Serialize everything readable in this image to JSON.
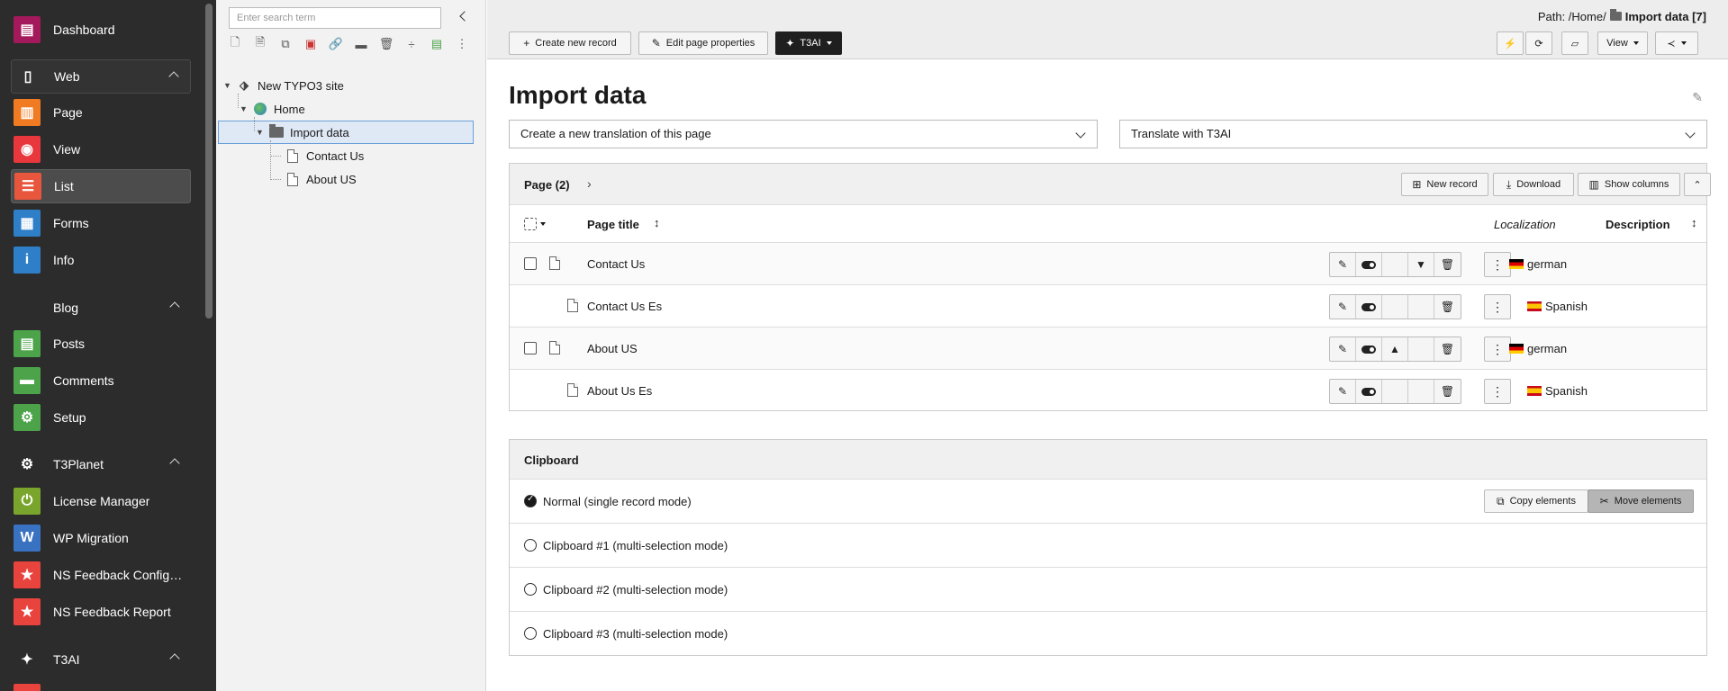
{
  "module_menu": {
    "items": [
      {
        "label": "Dashboard",
        "icon": "dashboard-icon",
        "color": "#a3195b"
      },
      {
        "label": "Web",
        "icon": "page-icon",
        "group": true
      },
      {
        "label": "Page",
        "icon": "page-module-icon",
        "color": "#f07b22"
      },
      {
        "label": "View",
        "icon": "eye-icon",
        "color": "#e8373d"
      },
      {
        "label": "List",
        "icon": "list-icon",
        "color": "#e8573d",
        "active": true
      },
      {
        "label": "Forms",
        "icon": "forms-icon",
        "color": "#2e7fc7"
      },
      {
        "label": "Info",
        "icon": "info-icon",
        "color": "#2e7fc7"
      },
      {
        "label": "Blog",
        "icon": "blog-icon",
        "group": true
      },
      {
        "label": "Posts",
        "icon": "posts-icon",
        "color": "#4ca34a"
      },
      {
        "label": "Comments",
        "icon": "comments-icon",
        "color": "#4ca34a"
      },
      {
        "label": "Setup",
        "icon": "setup-icon",
        "color": "#4ca34a"
      },
      {
        "label": "T3Planet",
        "icon": "gear-icon",
        "group": true
      },
      {
        "label": "License Manager",
        "icon": "license-icon",
        "color": "#7aa52d"
      },
      {
        "label": "WP Migration",
        "icon": "wordpress-icon",
        "color": "#3a72c2"
      },
      {
        "label": "NS Feedback Configur...",
        "icon": "star-icon",
        "color": "#e8433d"
      },
      {
        "label": "NS Feedback Report",
        "icon": "star-icon",
        "color": "#e8433d"
      },
      {
        "label": "T3AI",
        "icon": "sparkle-icon",
        "group": true
      }
    ]
  },
  "tree": {
    "search_placeholder": "Enter search term",
    "nodes": {
      "root": "New TYPO3 site",
      "home": "Home",
      "import": "Import data",
      "contact": "Contact Us",
      "about": "About US"
    }
  },
  "header": {
    "create_record": "Create new record",
    "edit_page": "Edit page properties",
    "t3ai": "T3AI",
    "view": "View",
    "path_label": "Path: /Home/",
    "path_page": "Import data [7]"
  },
  "page": {
    "title": "Import data",
    "translation_select": "Create a new translation of this page",
    "translate_ai_select": "Translate with T3AI"
  },
  "records": {
    "heading": "Page (2)",
    "new_record": "New record",
    "download": "Download",
    "show_columns": "Show columns",
    "columns": {
      "title": "Page title",
      "localization": "Localization",
      "description": "Description"
    },
    "rows": [
      {
        "title": "Contact Us",
        "lang": "german",
        "flag": "de"
      },
      {
        "title": "Contact Us Es",
        "lang": "Spanish",
        "flag": "es"
      },
      {
        "title": "About US",
        "lang": "german",
        "flag": "de"
      },
      {
        "title": "About Us Es",
        "lang": "Spanish",
        "flag": "es"
      }
    ]
  },
  "clipboard": {
    "heading": "Clipboard",
    "copy": "Copy elements",
    "move": "Move elements",
    "modes": [
      "Normal (single record mode)",
      "Clipboard #1 (multi-selection mode)",
      "Clipboard #2 (multi-selection mode)",
      "Clipboard #3 (multi-selection mode)"
    ]
  }
}
